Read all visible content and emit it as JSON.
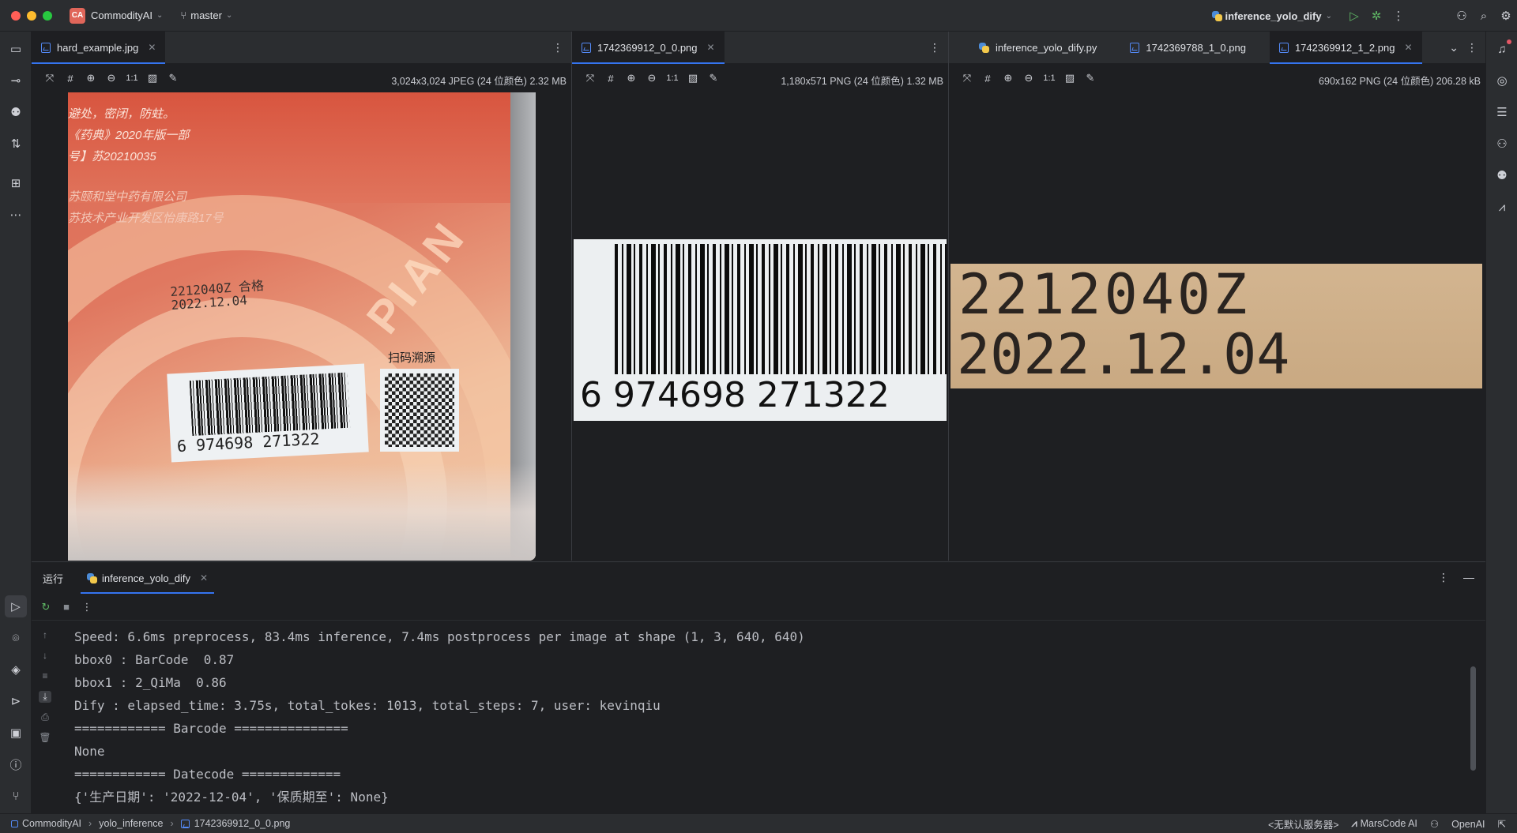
{
  "titlebar": {
    "project_badge": "CA",
    "project_name": "CommodityAI",
    "branch": "master",
    "run_config": "inference_yolo_dify"
  },
  "panes": [
    {
      "tabs": [
        {
          "label": "hard_example.jpg",
          "active": true
        }
      ],
      "info": "3,024x3,024 JPEG (24 位颜色) 2.32 MB"
    },
    {
      "tabs": [
        {
          "label": "1742369912_0_0.png",
          "active": true
        }
      ],
      "info": "1,180x571 PNG (24 位颜色) 1.32 MB"
    },
    {
      "tabs": [
        {
          "label": "inference_yolo_dify.py",
          "active": false
        },
        {
          "label": "1742369788_1_0.png",
          "active": false
        },
        {
          "label": "1742369912_1_2.png",
          "active": true
        }
      ],
      "info": "690x162 PNG (24 位颜色) 206.28 kB"
    }
  ],
  "image_text": {
    "package_lines": [
      "避处，密闭，防蛀。",
      "《药典》2020年版一部",
      "号】苏20210035",
      "苏颐和堂中药有限公司",
      "苏技术产业开发区怡康路17号"
    ],
    "batch": "2212040Z 合格",
    "date": "2022.12.04",
    "scan_label": "扫码溯源",
    "pian": "PIAN",
    "barcode_digits": "6  974698  271322",
    "crop_barcode": "6  974698  271322",
    "crop_line1": "2212040Z",
    "crop_line2": "2022.12.04"
  },
  "run_panel": {
    "title": "运行",
    "tab": "inference_yolo_dify",
    "lines": [
      "Speed: 6.6ms preprocess, 83.4ms inference, 7.4ms postprocess per image at shape (1, 3, 640, 640)",
      "bbox0 : BarCode  0.87",
      "bbox1 : 2_QiMa  0.86",
      "Dify : elapsed_time: 3.75s, total_tokes: 1013, total_steps: 7, user: kevinqiu",
      "============ Barcode ===============",
      "None",
      "============ Datecode =============",
      "{'生产日期': '2022-12-04', '保质期至': None}"
    ]
  },
  "statusbar": {
    "crumbs": [
      "CommodityAI",
      "yolo_inference",
      "1742369912_0_0.png"
    ],
    "server": "<无默认服务器>",
    "marscode": "MarsCode AI",
    "openai": "OpenAI"
  },
  "colors": {
    "accent": "#3574f0",
    "close": "#ff5f57",
    "minimize": "#febc2e",
    "zoom": "#28c840",
    "run_green": "#5fb865"
  }
}
